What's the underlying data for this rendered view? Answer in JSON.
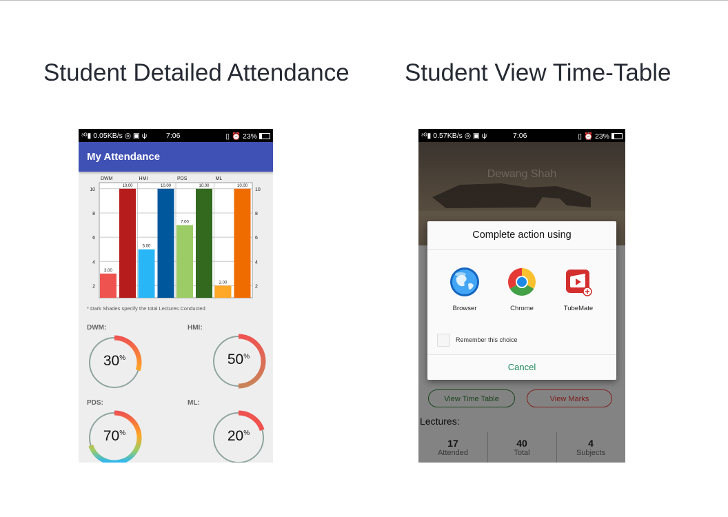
{
  "slide": {
    "left_title": "Student Detailed Attendance",
    "right_title": "Student View Time-Table"
  },
  "phone_left": {
    "status": {
      "left": "0.05KB/s",
      "time": "7:06",
      "battery": "23%"
    },
    "app_title": "My Attendance",
    "chart_note": "* Dark Shades specify the total Lectures Conducted",
    "donuts": [
      {
        "label": "DWM:",
        "value": "30",
        "unit": "%",
        "fraction": 0.3
      },
      {
        "label": "HMI:",
        "value": "50",
        "unit": "%",
        "fraction": 0.5
      },
      {
        "label": "PDS:",
        "value": "70",
        "unit": "%",
        "fraction": 0.7
      },
      {
        "label": "ML:",
        "value": "20",
        "unit": "%",
        "fraction": 0.2
      }
    ]
  },
  "chart_data": {
    "type": "bar",
    "categories": [
      "DWM",
      "HMI",
      "PDS",
      "ML"
    ],
    "series": [
      {
        "values": [
          3.0,
          5.0,
          7.0,
          2.0
        ],
        "labels": [
          "3.00",
          "5.00",
          "7.00",
          "2.00"
        ],
        "colors": [
          "#ef5350",
          "#29b6f6",
          "#9ccc65",
          "#ffa726"
        ]
      },
      {
        "values": [
          10.0,
          10.0,
          10.0,
          10.0
        ],
        "labels": [
          "10.00",
          "10.00",
          "10.00",
          "10.00"
        ],
        "colors": [
          "#b71c1c",
          "#01579b",
          "#33691e",
          "#ef6c00"
        ]
      }
    ],
    "yticks": [
      "2",
      "4",
      "6",
      "8",
      "10"
    ],
    "ylim": [
      1,
      10.5
    ],
    "grid": true
  },
  "phone_right": {
    "status": {
      "left": "0.57KB/s",
      "time": "7:06",
      "battery": "23%"
    },
    "cover_name": "Dewang Shah",
    "dialog": {
      "title": "Complete action using",
      "apps": [
        {
          "name": "Browser",
          "icon": "browser-globe-icon"
        },
        {
          "name": "Chrome",
          "icon": "chrome-icon"
        },
        {
          "name": "TubeMate",
          "icon": "tubemate-icon"
        }
      ],
      "remember": "Remember this choice",
      "cancel": "Cancel"
    },
    "buttons": {
      "timetable": "View Time Table",
      "marks": "View Marks"
    },
    "lectures_label": "Lectures:",
    "stats": [
      {
        "value": "17",
        "label": "Attended"
      },
      {
        "value": "40",
        "label": "Total"
      },
      {
        "value": "4",
        "label": "Subjects"
      }
    ]
  }
}
